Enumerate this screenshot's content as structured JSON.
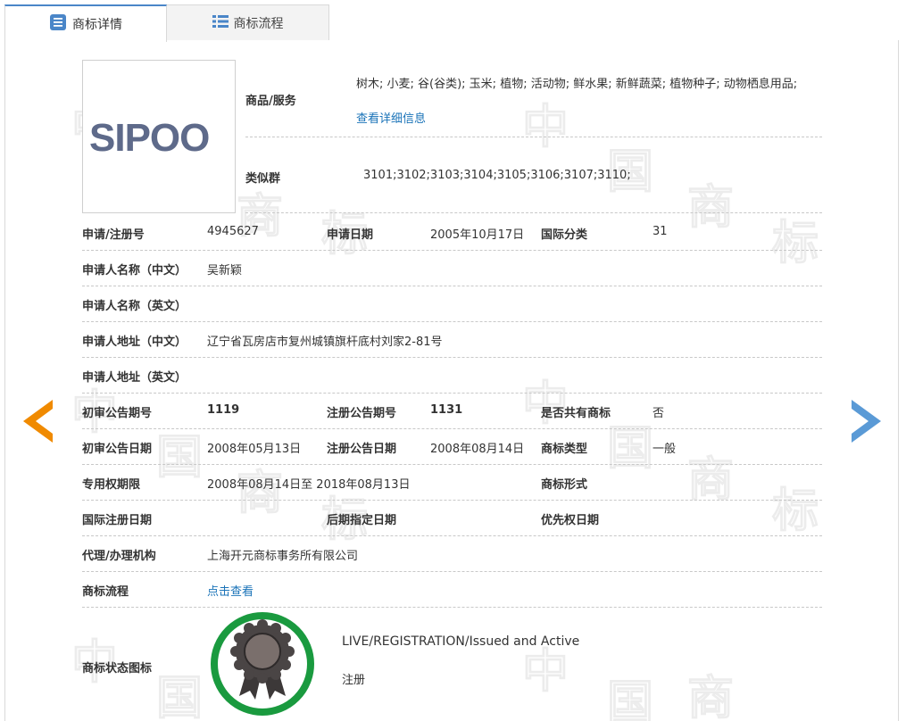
{
  "tabs": [
    {
      "label": "商标详情",
      "icon": "document-list-icon",
      "active": true
    },
    {
      "label": "商标流程",
      "icon": "list-grid-icon",
      "active": false
    }
  ],
  "logo": {
    "text": "SIPOO"
  },
  "goods": {
    "label": "商品/服务",
    "value": "树木; 小麦; 谷(谷类); 玉米; 植物; 活动物; 鲜水果; 新鲜蔬菜; 植物种子; 动物栖息用品;",
    "link": "查看详细信息"
  },
  "similar_group": {
    "label": "类似群",
    "value": "3101;3102;3103;3104;3105;3106;3107;3110;"
  },
  "fields": {
    "reg_no_label": "申请/注册号",
    "reg_no": "4945627",
    "app_date_label": "申请日期",
    "app_date": "2005年10月17日",
    "intl_class_label": "国际分类",
    "intl_class": "31",
    "applicant_cn_label": "申请人名称（中文）",
    "applicant_cn": "吴新颖",
    "applicant_en_label": "申请人名称（英文）",
    "applicant_en": "",
    "address_cn_label": "申请人地址（中文）",
    "address_cn": "辽宁省瓦房店市复州城镇旗杆底村刘家2-81号",
    "address_en_label": "申请人地址（英文）",
    "address_en": "",
    "prelim_issue_label": "初审公告期号",
    "prelim_issue": "1119",
    "reg_issue_label": "注册公告期号",
    "reg_issue": "1131",
    "shared_label": "是否共有商标",
    "shared": "否",
    "prelim_date_label": "初审公告日期",
    "prelim_date": "2008年05月13日",
    "reg_date_label": "注册公告日期",
    "reg_date": "2008年08月14日",
    "tm_type_label": "商标类型",
    "tm_type": "一般",
    "exclusive_label": "专用权期限",
    "exclusive": "2008年08月14日至 2018年08月13日",
    "tm_form_label": "商标形式",
    "tm_form": "",
    "intl_reg_label": "国际注册日期",
    "intl_reg": "",
    "later_label": "后期指定日期",
    "later": "",
    "priority_label": "优先权日期",
    "priority": "",
    "agent_label": "代理/办理机构",
    "agent": "上海开元商标事务所有限公司",
    "process_label": "商标流程",
    "process_link": "点击查看",
    "status_icon_label": "商标状态图标"
  },
  "status": {
    "en": "LIVE/REGISTRATION/Issued and Active",
    "cn": "注册",
    "ring_color": "#1a9a3f"
  },
  "watermark": [
    "中",
    "国",
    "商",
    "标"
  ],
  "colors": {
    "prev_arrow": "#f08a00",
    "next_arrow": "#5a9ad6",
    "link": "#1a73b8",
    "tab_accent": "#4a86c8"
  }
}
